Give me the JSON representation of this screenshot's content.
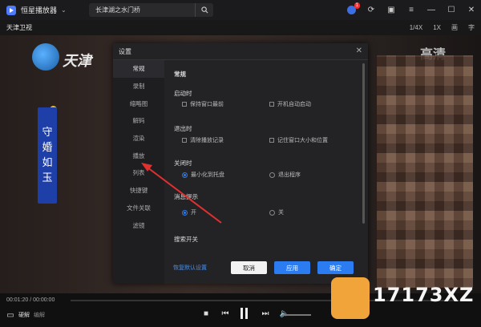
{
  "titlebar": {
    "app_title": "恒星播放器",
    "search_value": "长津湖之水门桥",
    "notification_count": "1"
  },
  "subbar": {
    "channel": "天津卫视",
    "items": [
      "1/4X",
      "1X",
      "画",
      "字"
    ]
  },
  "video": {
    "station_name": "天津",
    "quality_label": "高清",
    "drama_title": [
      "守",
      "婚",
      "如",
      "玉"
    ]
  },
  "dialog": {
    "title": "设置",
    "sidebar": [
      "常规",
      "录制",
      "缩略图",
      "解码",
      "渲染",
      "播放",
      "列表",
      "快捷键",
      "文件关联",
      "滤镜"
    ],
    "active_item": "常规",
    "main_title": "常规",
    "startup": {
      "label": "启动时",
      "options": [
        "保持窗口最前",
        "开机自动启动"
      ]
    },
    "exit": {
      "label": "退出时",
      "options": [
        "清除播放记录",
        "记住窗口大小和位置"
      ]
    },
    "close": {
      "label": "关闭时",
      "options": [
        "最小化到托盘",
        "退出程序"
      ],
      "selected": "最小化到托盘"
    },
    "notify": {
      "label": "消息提示",
      "options": [
        "开",
        "关"
      ],
      "selected": "开"
    },
    "search_label": "搜索开关",
    "restore_link": "恢复默认设置",
    "cancel": "取消",
    "apply": "应用",
    "ok": "确定"
  },
  "controls": {
    "time": "00:01:20 / 00:00:00",
    "hw": "硬解",
    "codec": "编解"
  },
  "watermark": {
    "text": "17173XZ"
  },
  "colors": {
    "accent": "#2a7cf0",
    "arrow": "#e03030",
    "dialog_bg": "#232326"
  }
}
